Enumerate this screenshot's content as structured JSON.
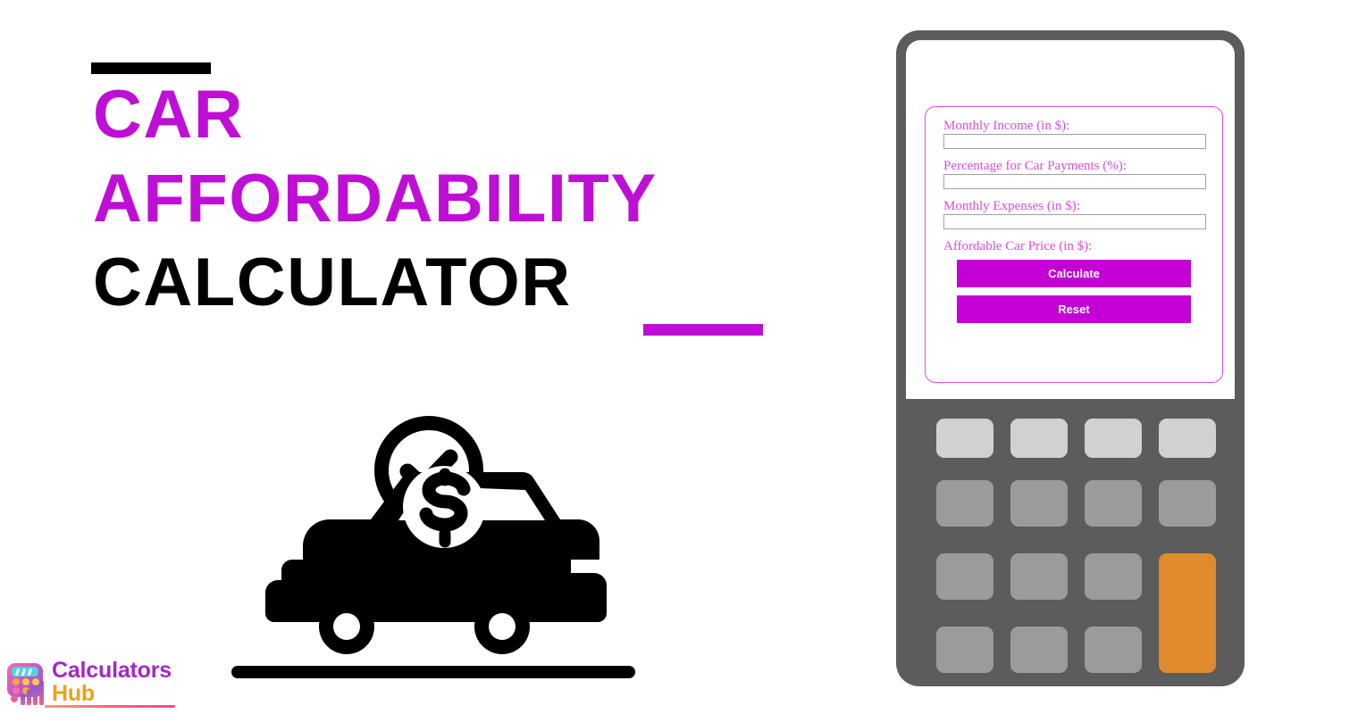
{
  "page": {
    "background": "#ffffff",
    "accent_magenta": "#bf0fd6",
    "accent_black": "#000000"
  },
  "title": {
    "line1": "CAR",
    "line2": "AFFORDABILITY",
    "line3": "CALCULATOR",
    "line1_color": "#bf0fd6",
    "line2_color": "#bf0fd6",
    "line3_color": "#000000",
    "top_bar_color": "#000000",
    "bottom_bar_color": "#bf0fd6"
  },
  "illustration": {
    "name": "car-with-dollar-and-check-illustration",
    "parts": [
      "check-circle-icon",
      "car-side-icon",
      "dollar-sign-icon",
      "ground-line"
    ],
    "color": "#000000"
  },
  "logo": {
    "word1": "Calculators",
    "word2": "Hub",
    "word1_color": "#a626c9",
    "word2_color": "#e8a317",
    "icon_name": "calculator-bars-logo-icon"
  },
  "device": {
    "body_color": "#5c5c5c",
    "screen_color": "#ffffff",
    "key_light_color": "#d1d1d1",
    "key_color": "#9b9b9b",
    "key_accent_color": "#e08a2e",
    "keypad_rows": 4,
    "keypad_cols": 4
  },
  "form": {
    "border_color": "#e24ae2",
    "label_color": "#e04ae0",
    "fields": [
      {
        "label": "Monthly Income (in $):",
        "value": "",
        "placeholder": ""
      },
      {
        "label": "Percentage for Car Payments (%):",
        "value": "",
        "placeholder": ""
      },
      {
        "label": "Monthly Expenses (in $):",
        "value": "",
        "placeholder": ""
      }
    ],
    "result_label": "Affordable Car Price (in $):",
    "result_value": "",
    "buttons": [
      {
        "label": "Calculate",
        "color": "#c400d6"
      },
      {
        "label": "Reset",
        "color": "#c400d6"
      }
    ]
  }
}
